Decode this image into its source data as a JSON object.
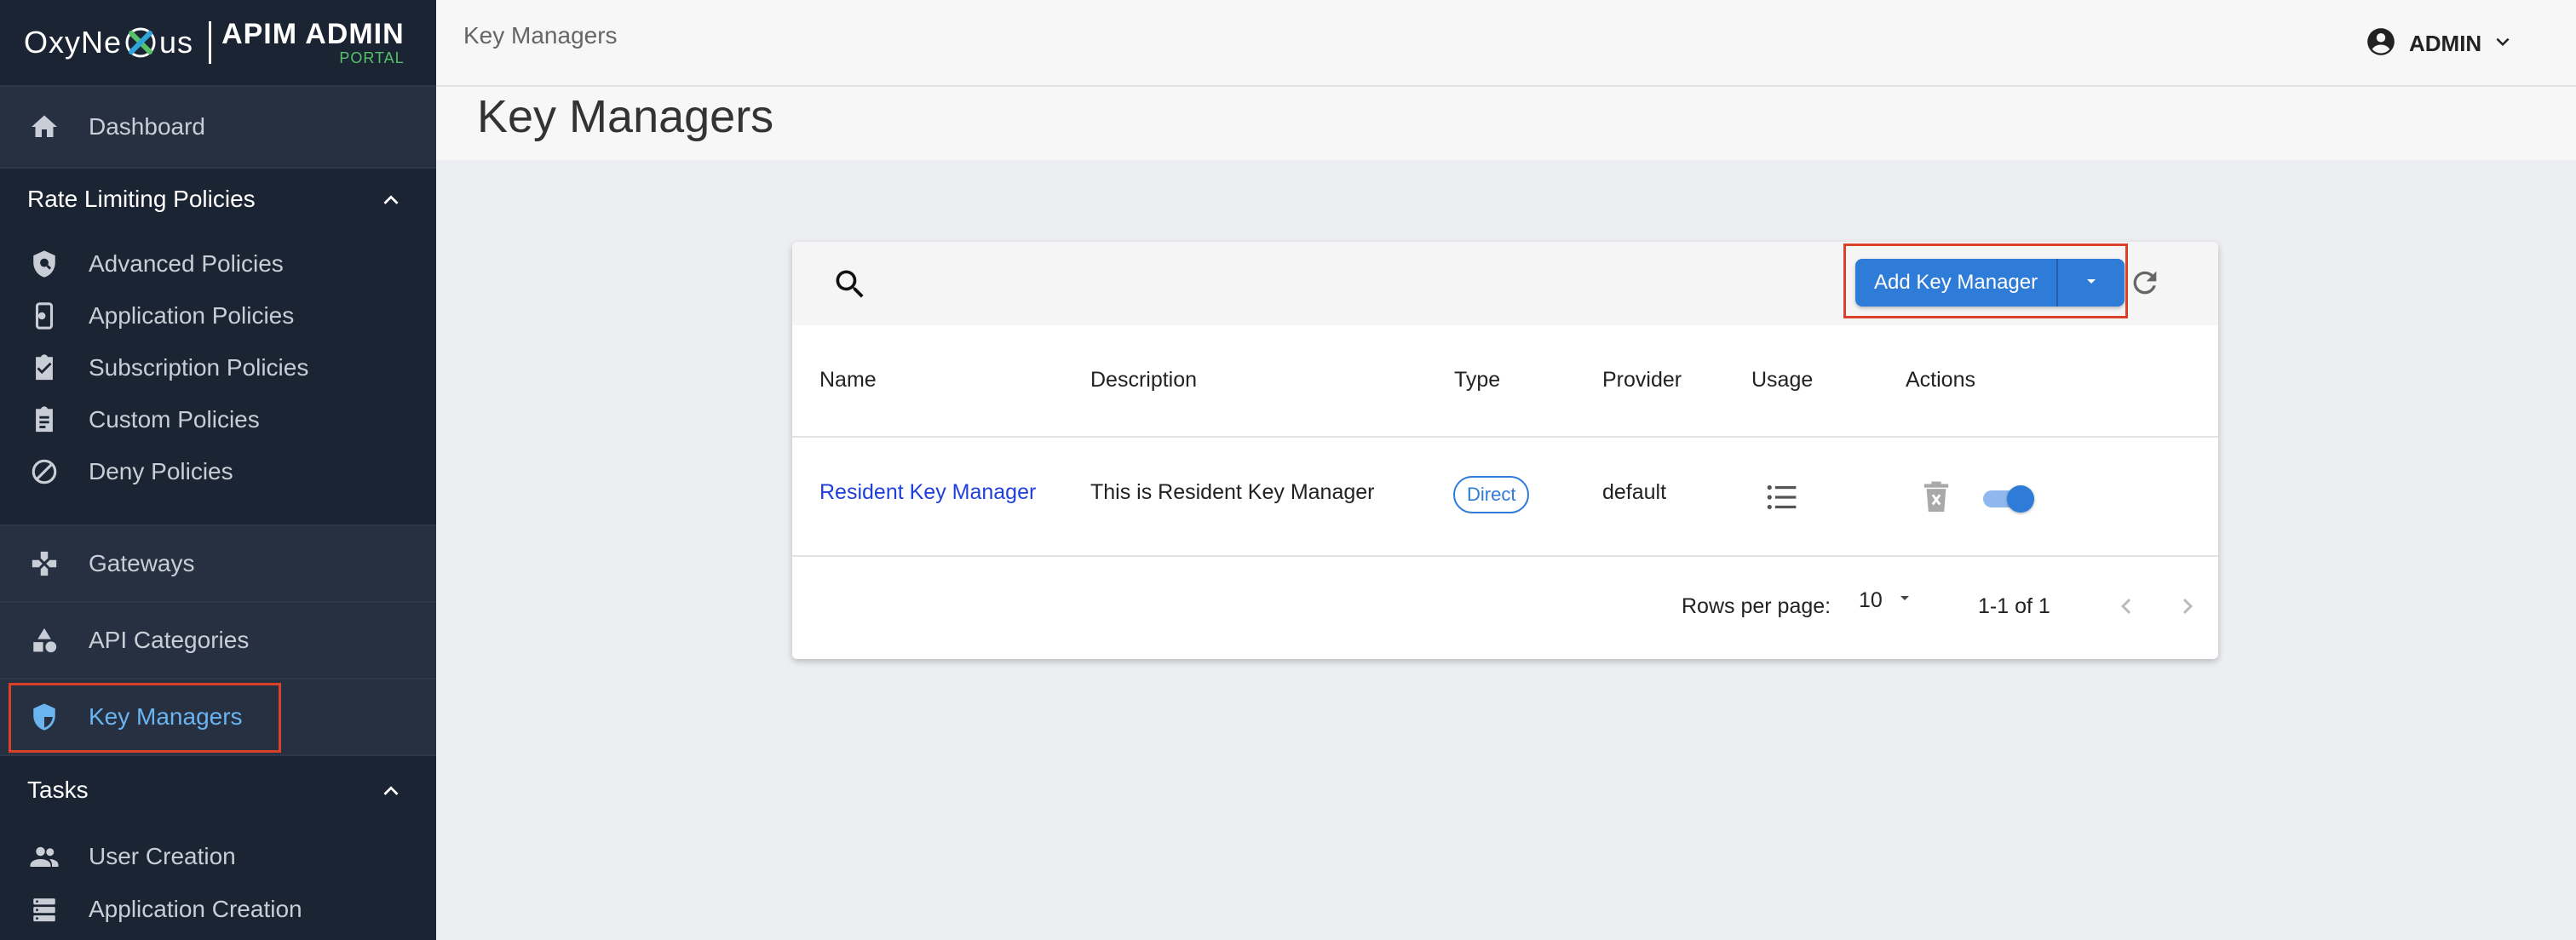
{
  "brand": {
    "logo_prefix": "OxyNe",
    "logo_suffix": "us",
    "product_line1": "APIM ADMIN",
    "product_line2": "PORTAL"
  },
  "sidebar": {
    "dashboard": "Dashboard",
    "rate_limiting_header": "Rate Limiting Policies",
    "rate_items": [
      {
        "label": "Advanced Policies",
        "icon": "shield-search-icon"
      },
      {
        "label": "Application Policies",
        "icon": "phone-settings-icon"
      },
      {
        "label": "Subscription Policies",
        "icon": "clipboard-check-icon"
      },
      {
        "label": "Custom Policies",
        "icon": "clipboard-list-icon"
      },
      {
        "label": "Deny Policies",
        "icon": "block-icon"
      }
    ],
    "gateways": "Gateways",
    "api_categories": "API Categories",
    "key_managers": "Key Managers",
    "tasks_header": "Tasks",
    "task_items": [
      {
        "label": "User Creation",
        "icon": "users-icon"
      },
      {
        "label": "Application Creation",
        "icon": "storage-icon"
      }
    ]
  },
  "header": {
    "breadcrumb": "Key Managers",
    "user": "ADMIN"
  },
  "page": {
    "title": "Key Managers"
  },
  "toolbar": {
    "add_button": "Add Key Manager"
  },
  "table": {
    "columns": [
      "Name",
      "Description",
      "Type",
      "Provider",
      "Usage",
      "Actions"
    ],
    "rows": [
      {
        "name": "Resident Key Manager",
        "description": "This is Resident Key Manager",
        "type": "Direct",
        "provider": "default",
        "enabled": true
      }
    ]
  },
  "pagination": {
    "rows_per_page_label": "Rows per page:",
    "rows_per_page": "10",
    "range": "1-1 of 1"
  },
  "colors": {
    "sidebar_bg": "#1b2432",
    "accent": "#2e7bd8",
    "active_nav": "#6ab4f0",
    "highlight": "#d9412b"
  }
}
